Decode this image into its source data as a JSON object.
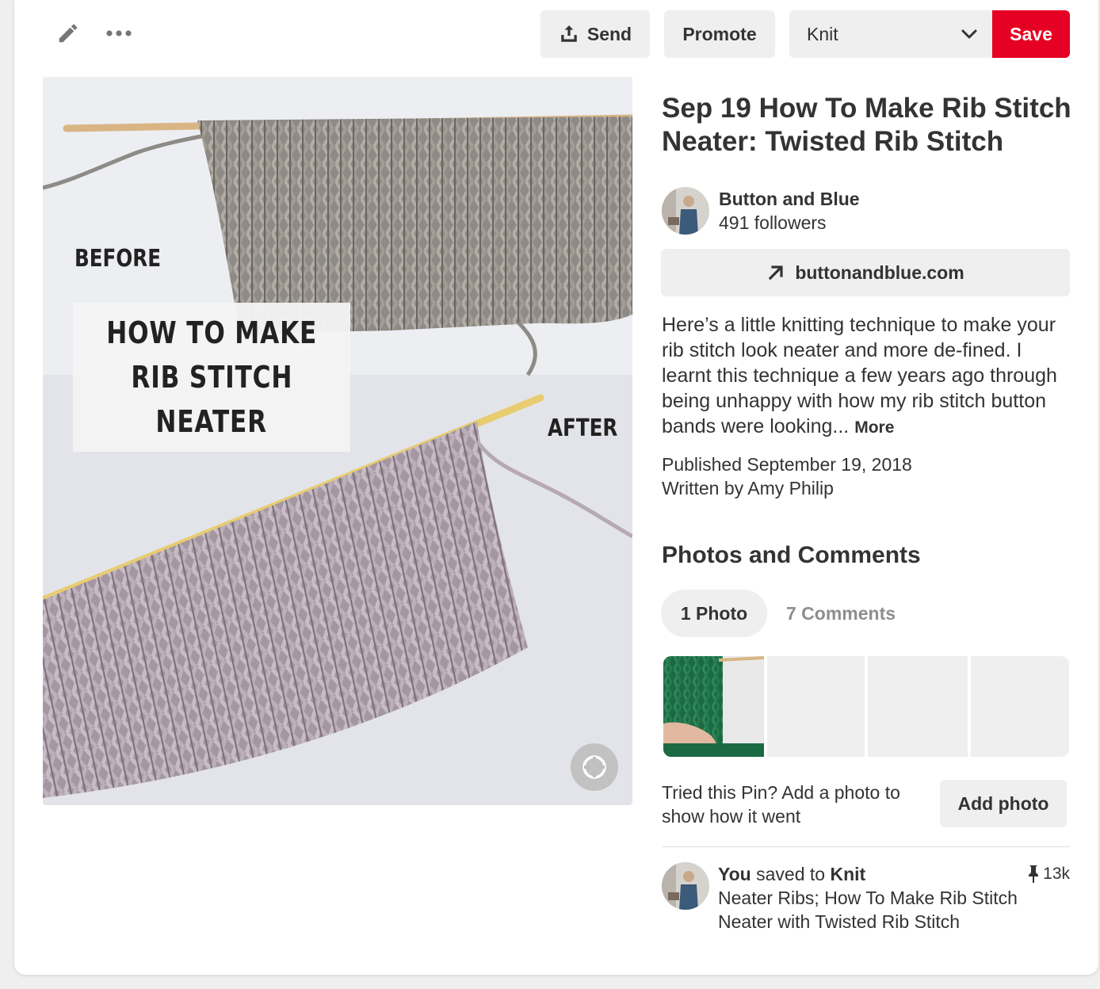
{
  "toolbar": {
    "send_label": "Send",
    "promote_label": "Promote",
    "board_selected": "Knit",
    "save_label": "Save"
  },
  "pin_image": {
    "before_label": "BEFORE",
    "after_label": "AFTER",
    "overlay_lines": [
      "HOW TO MAKE",
      "RIB STITCH",
      "NEATER"
    ]
  },
  "pin": {
    "title": "Sep 19 How To Make Rib Stitch Neater: Twisted Rib Stitch",
    "author_name": "Button and Blue",
    "author_followers": "491 followers",
    "link_label": "buttonandblue.com",
    "description": "Here’s a little knitting technique to make your rib stitch look neater and more de-fined. I learnt this technique a few years ago through being unhappy with how my rib stitch button bands were looking...",
    "more_label": "More",
    "published": "Published September 19, 2018",
    "written_by": "Written by Amy Philip"
  },
  "photos_comments": {
    "title": "Photos and Comments",
    "tab_photos": "1 Photo",
    "tab_comments": "7 Comments",
    "tried_text": "Tried this Pin? Add a photo to show how it went",
    "add_photo_label": "Add photo"
  },
  "activity": {
    "you": "You",
    "saved_to": "saved to",
    "board": "Knit",
    "pin_count": "13k",
    "note": "Neater Ribs; How To Make Rib Stitch Neater with Twisted Rib Stitch"
  },
  "colors": {
    "save_red": "#e60023",
    "button_gray": "#efefef",
    "text_dark": "#333333",
    "text_muted": "#8e8e8e"
  }
}
